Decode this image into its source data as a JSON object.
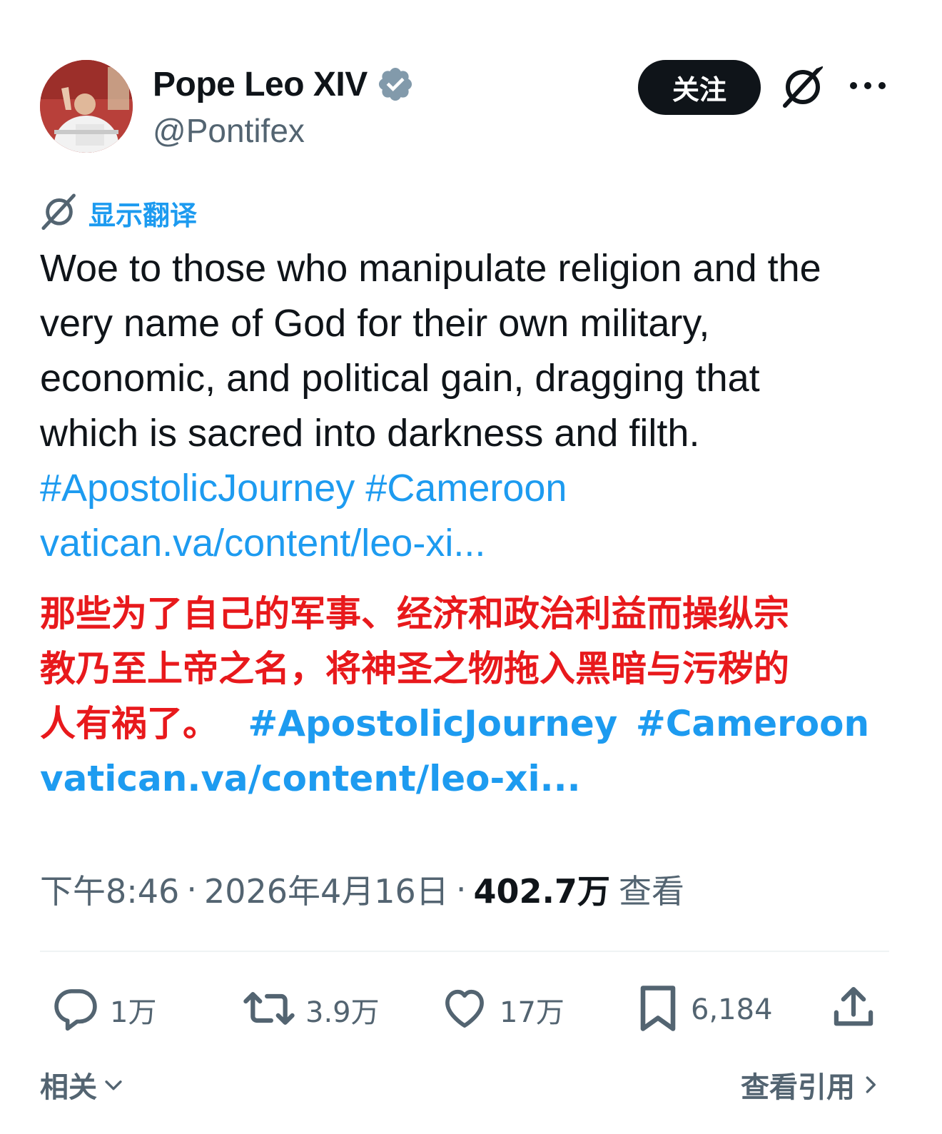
{
  "author": {
    "name": "Pope Leo XIV",
    "handle": "@Pontifex",
    "verified": true
  },
  "header": {
    "follow_label": "关注",
    "grok_icon": "grok-icon",
    "more_icon": "more-icon"
  },
  "translate": {
    "label": "显示翻译"
  },
  "tweet": {
    "lines": [
      "Woe to those who manipulate religion and the",
      "very name of God for their own military,",
      "economic, and political gain, dragging that",
      "which is sacred into darkness and filth."
    ],
    "hashtag1": "#ApostolicJourney",
    "hashtag2": "#Cameroon",
    "url": "vatican.va/content/leo-xi..."
  },
  "overlay": {
    "line1": "那些为了自己的军事、经济和政治利益而操纵宗",
    "line2": "教乃至上帝之名，将神圣之物拖入黑暗与污秽的",
    "line3_red": "人有祸了。",
    "hashtag1": "#ApostolicJourney",
    "hashtag2": "#Cameroon",
    "url": "vatican.va/content/leo-xi...",
    "text_color": "#e8191c",
    "link_color": "#1d9bf0"
  },
  "meta": {
    "time": "下午8:46",
    "date": "2026年4月16日",
    "views_count": "402.7万",
    "views_label": "查看"
  },
  "actions": {
    "replies": "1万",
    "reposts": "3.9万",
    "likes": "17万",
    "bookmarks": "6,184"
  },
  "footer": {
    "related_label": "相关",
    "view_quotes_label": "查看引用"
  },
  "colors": {
    "accent": "#1d9bf0",
    "verified_badge": "#829aab",
    "text_primary": "#0f1419",
    "text_secondary": "#536471"
  }
}
